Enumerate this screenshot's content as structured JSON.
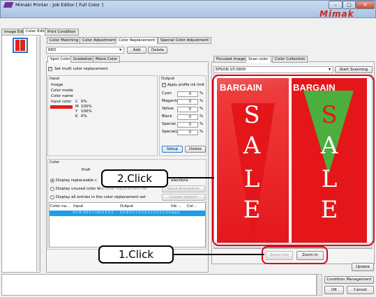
{
  "window": {
    "title": "Mimaki Printer : Job Editor [ Full Color ]",
    "brand": "Mimak",
    "minimize": "–",
    "maximize": "□",
    "close": "✕"
  },
  "main_tabs": [
    "Image Edit",
    "Color Edit",
    "Print Condition"
  ],
  "sub_tabs": [
    "Color Matching",
    "Color Adjustment",
    "Color Replacement",
    "Special Color Adjustment"
  ],
  "replacement_set": {
    "value": "RED",
    "add_label": "Add",
    "delete_label": "Delete"
  },
  "left_tabs": [
    "Spot Color",
    "Gradation",
    "Mono Color"
  ],
  "set_multi": "Set multi color replacement",
  "input": {
    "title": "Input",
    "rows": [
      "Image",
      "Color mode",
      "Color name"
    ],
    "input_color_label": "Input color",
    "cmyk": [
      {
        "ch": "C",
        "val": "0%"
      },
      {
        "ch": "M",
        "val": "100%"
      },
      {
        "ch": "Y",
        "val": "100%"
      },
      {
        "ch": "K",
        "val": "0%"
      }
    ],
    "swatch_color": "#e0201c"
  },
  "output": {
    "title": "Output",
    "apply_limit": "Apply profile ink limit",
    "channels": [
      {
        "name": "Cyan",
        "value": "0",
        "unit": "%"
      },
      {
        "name": "Magenta",
        "value": "0",
        "unit": "%"
      },
      {
        "name": "Yellow",
        "value": "0",
        "unit": "%"
      },
      {
        "name": "Black",
        "value": "0",
        "unit": "%"
      },
      {
        "name": "Special",
        "value": "0",
        "unit": "%"
      },
      {
        "name": "Special2",
        "value": "0",
        "unit": "%"
      }
    ],
    "setup_label": "Setup",
    "delete_label": "Delete"
  },
  "color_section": {
    "title": "Color",
    "profile_label": "Profi",
    "option1": "Display replaceable c",
    "option1_suffix": "elections",
    "option2": "Display unused color in",
    "option2_hidden_suffix": "the color replacement set",
    "value_acq": "Value Acquisition",
    "option3": "Display all entries in the color replacement set",
    "create_swatch": "Create Swatch",
    "columns": [
      "Color na...",
      "Input",
      "Output",
      "Ink ...",
      "Col..."
    ],
    "row": {
      "input": "0.0 M 100.0 Y 100.0 K 0.0",
      "output": "0.0 M 0.0 Y 0.0 K 0.0 S 0.0 S 0.0",
      "ink": "Apply"
    }
  },
  "right_tabs": [
    "Focused image",
    "Scan color",
    "Color Collection"
  ],
  "scanner": {
    "value": "EPSON GT-X800",
    "start_label": "Start Scanning"
  },
  "preview": {
    "left_banner": {
      "top_text": "BARGAIN",
      "letters": [
        "S",
        "A",
        "L",
        "E"
      ]
    },
    "right_banner": {
      "top_text": "BARGAIN",
      "letters": [
        "S",
        "A",
        "L",
        "E"
      ]
    }
  },
  "zoom": {
    "out_label": "Zoom Out",
    "in_label": "Zoom In"
  },
  "update_label": "Update",
  "callouts": {
    "one": "1.Click",
    "two": "2.Click"
  },
  "footer": {
    "condition_label": "Condition Management",
    "ok_label": "OK",
    "cancel_label": "Cancel"
  }
}
